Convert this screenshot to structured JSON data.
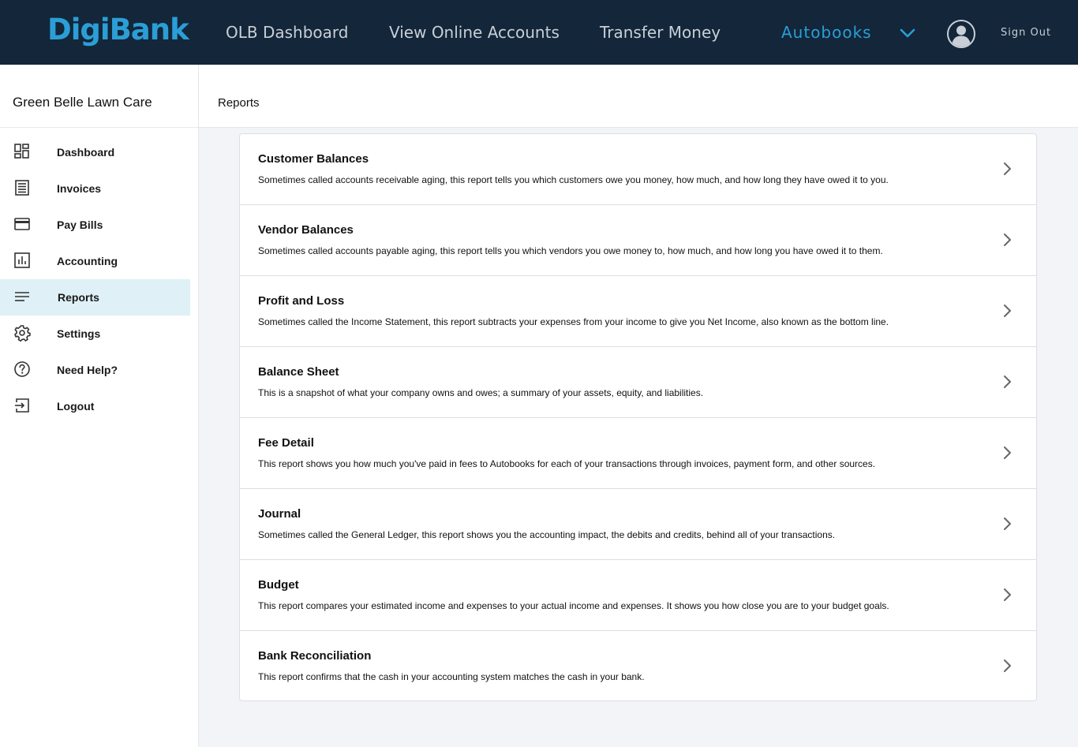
{
  "topbar": {
    "logo": "DigiBank",
    "nav": [
      {
        "label": "OLB Dashboard"
      },
      {
        "label": "View Online Accounts"
      },
      {
        "label": "Transfer Money"
      },
      {
        "label": "Autobooks"
      }
    ],
    "sign_out": "Sign Out",
    "icons": {
      "dropdown": "chevron-down-icon",
      "account": "user-avatar-icon"
    },
    "colors": {
      "background": "#13263a",
      "accent": "#2b9ed6"
    }
  },
  "sidebar": {
    "company_name": "Green Belle Lawn Care",
    "items": [
      {
        "label": "Dashboard",
        "icon": "dashboard-icon"
      },
      {
        "label": "Invoices",
        "icon": "invoice-icon"
      },
      {
        "label": "Pay Bills",
        "icon": "credit-card-icon"
      },
      {
        "label": "Accounting",
        "icon": "bar-chart-icon"
      },
      {
        "label": "Reports",
        "icon": "lines-icon",
        "active": true
      },
      {
        "label": "Settings",
        "icon": "gear-icon"
      },
      {
        "label": "Need Help?",
        "icon": "help-icon"
      },
      {
        "label": "Logout",
        "icon": "logout-icon"
      }
    ],
    "active_color": "#dff0f6"
  },
  "header": {
    "title": "Reports"
  },
  "reports": [
    {
      "title": "Customer Balances",
      "description": "Sometimes called accounts receivable aging, this report tells you which customers owe you money, how much, and how long they have owed it to you."
    },
    {
      "title": "Vendor Balances",
      "description": "Sometimes called accounts payable aging, this report tells you which vendors you owe money to, how much, and how long you have owed it to them."
    },
    {
      "title": "Profit and Loss",
      "description": "Sometimes called the Income Statement, this report subtracts your expenses from your income to give you Net Income, also known as the bottom line."
    },
    {
      "title": "Balance Sheet",
      "description": "This is a snapshot of what your company owns and owes; a summary of your assets, equity, and liabilities."
    },
    {
      "title": "Fee Detail",
      "description": "This report shows you how much you've paid in fees to Autobooks for each of your transactions through invoices, payment form, and other sources."
    },
    {
      "title": "Journal",
      "description": "Sometimes called the General Ledger, this report shows you the accounting impact, the debits and credits, behind all of your transactions."
    },
    {
      "title": "Budget",
      "description": "This report compares your estimated income and expenses to your actual income and expenses. It shows you how close you are to your budget goals."
    },
    {
      "title": "Bank Reconciliation",
      "description": "This report confirms that the cash in your accounting system matches the cash in your bank."
    }
  ]
}
